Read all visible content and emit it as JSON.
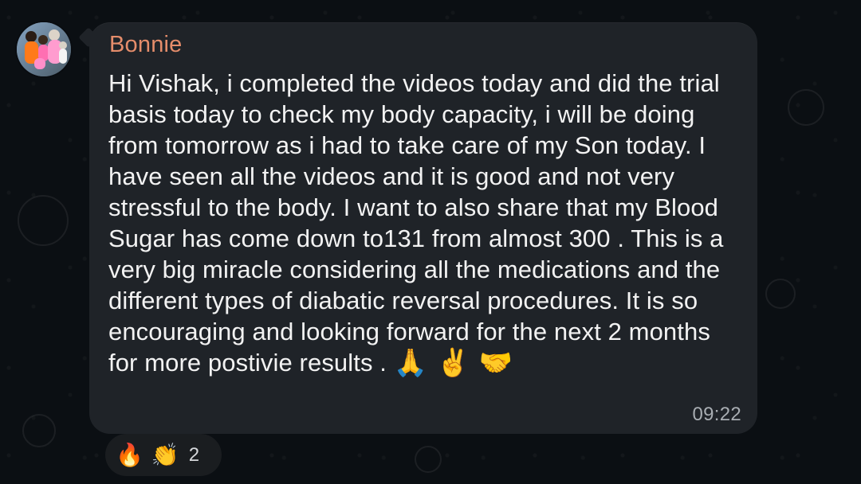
{
  "chat": {
    "sender_name": "Bonnie",
    "message_text": "Hi Vishak, i completed the videos today and did the trial basis today to check my body capacity, i will be doing from tomorrow as i had to take care of my Son today. I have seen all the videos and it is good and not very stressful to the body. I want to also share that my Blood Sugar has come down to131 from almost 300 . This is a very big miracle considering all the medications and the different types of diabatic reversal procedures. It is so encouraging and looking forward for the next 2 months for more postivie results . ",
    "message_emojis": [
      "🙏",
      "✌️",
      "🤝"
    ],
    "timestamp": "09:22"
  },
  "reactions": {
    "emojis": [
      "🔥",
      "👏"
    ],
    "count": "2"
  },
  "colors": {
    "background": "#0b0f13",
    "bubble": "#1f2328",
    "sender_name": "#e58d6b",
    "message_text": "#f2f2f2",
    "timestamp": "#a8adb2",
    "reaction_pill": "#1a1d20"
  }
}
